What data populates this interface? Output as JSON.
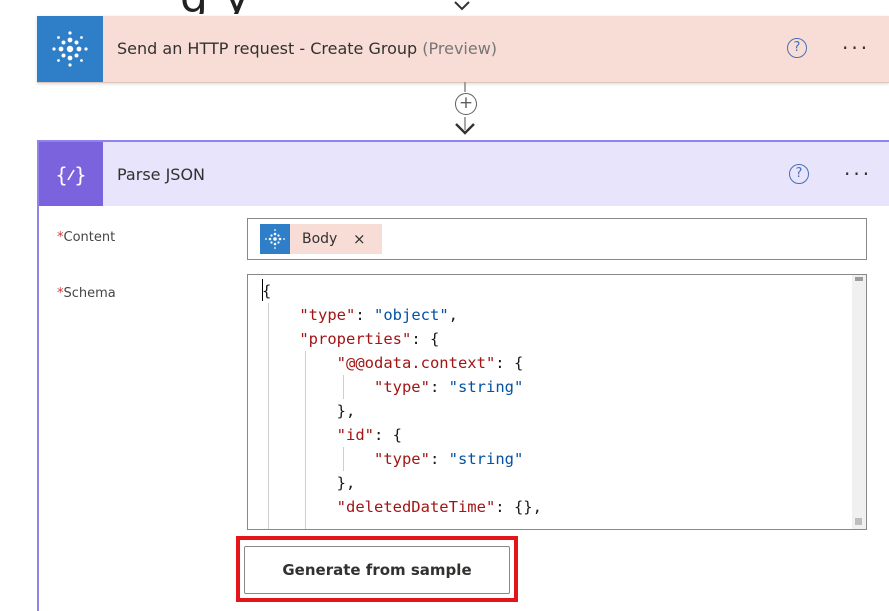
{
  "top_heading": {
    "text": "g          y"
  },
  "http_action": {
    "title": "Send an HTTP request - Create Group",
    "preview_tag": "(Preview)",
    "help_label": "?",
    "more_label": "···",
    "icon": "sharepoint-icon"
  },
  "connector": {
    "add_label": "+"
  },
  "parse_json": {
    "title": "Parse JSON",
    "help_label": "?",
    "more_label": "···",
    "icon": "braces-icon",
    "content_field": {
      "label": "Content",
      "required_mark": "*",
      "token_label": "Body",
      "token_remove": "×"
    },
    "schema_field": {
      "label": "Schema",
      "required_mark": "*",
      "code_lines": [
        "{",
        "    \"type\": \"object\",",
        "    \"properties\": {",
        "        \"@@odata.context\": {",
        "            \"type\": \"string\"",
        "        },",
        "        \"id\": {",
        "            \"type\": \"string\"",
        "        },",
        "        \"deletedDateTime\": {},"
      ]
    },
    "generate_button": "Generate from sample"
  },
  "colors": {
    "http_card_bg": "#f8ddd6",
    "sharepoint_blue": "#2e7fc7",
    "parse_header_bg": "#e8e4fb",
    "parse_icon_bg": "#7a63dd",
    "highlight_red": "#e3151b",
    "json_key": "#a31515",
    "json_string": "#0451a5"
  }
}
